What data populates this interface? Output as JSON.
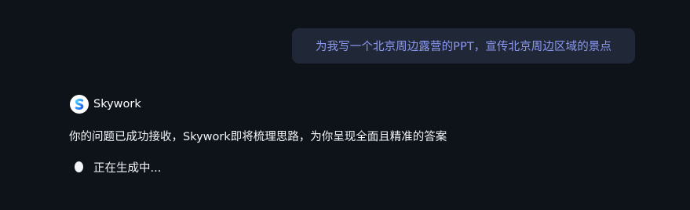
{
  "conversation": {
    "user_message": "为我写一个北京周边露营的PPT，宣传北京周边区域的景点",
    "assistant": {
      "name": "Skywork",
      "logo_icon": "skywork-logo-icon",
      "response": "你的问题已成功接收，Skywork即将梳理思路，为你呈现全面且精准的答案",
      "status": "正在生成中..."
    }
  },
  "colors": {
    "background": "#0e131a",
    "user_bubble": "#202837",
    "user_text": "#8c99f2",
    "assistant_text": "#f2f4f7"
  }
}
